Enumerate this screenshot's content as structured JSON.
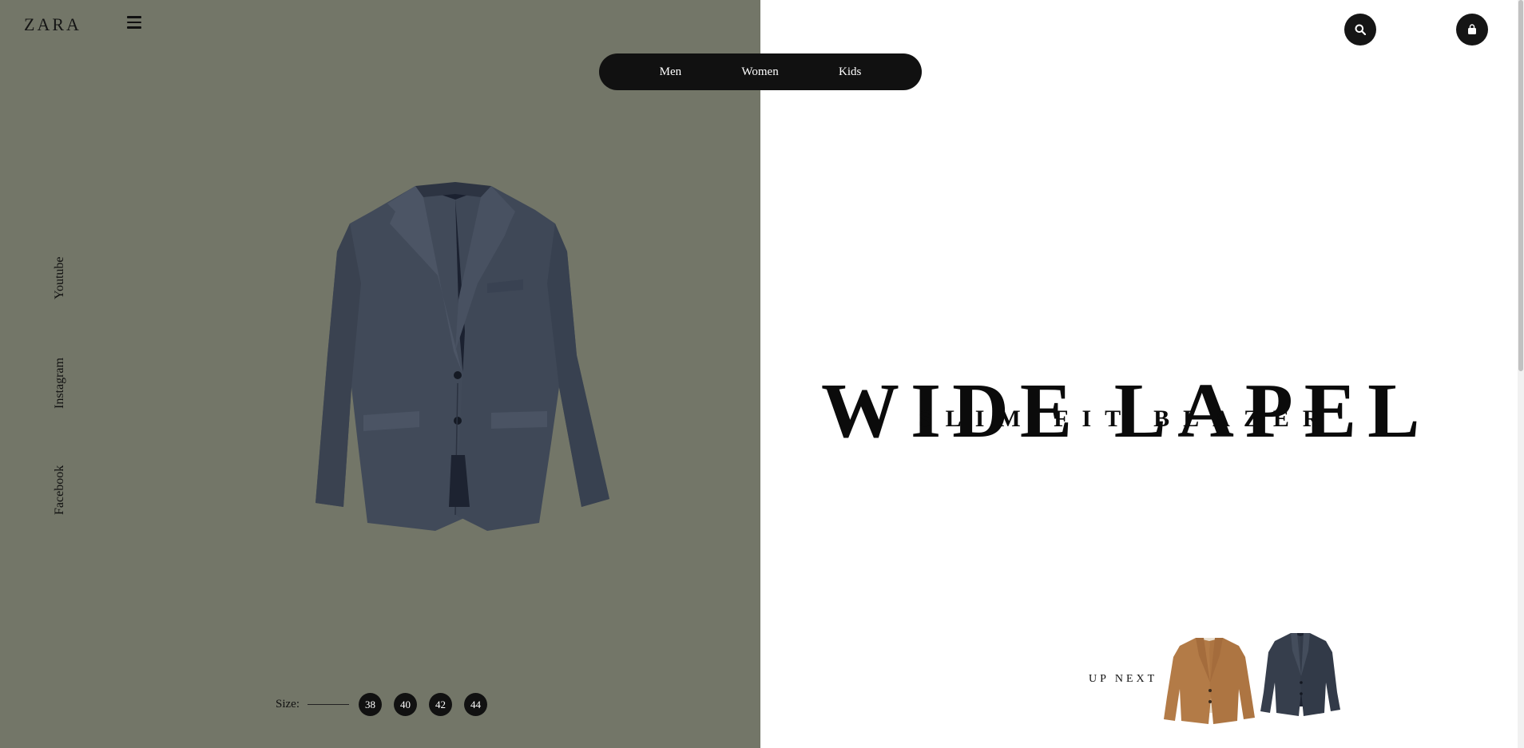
{
  "brand": {
    "logo": "ZARA"
  },
  "nav": {
    "items": [
      {
        "label": "Men"
      },
      {
        "label": "Women"
      },
      {
        "label": "Kids"
      }
    ]
  },
  "icons": {
    "menu": "hamburger-menu-icon",
    "search": "search-icon",
    "bag": "shopping-bag-icon"
  },
  "social": {
    "youtube": "Youtube",
    "instagram": "Instagram",
    "facebook": "Facebook"
  },
  "product": {
    "title": "WIDE LAPEL",
    "subtitle": "SLIM FIT BLAZER",
    "sizes_label": "Size:",
    "sizes": [
      "38",
      "40",
      "42",
      "44"
    ]
  },
  "up_next": {
    "label": "UP NEXT"
  },
  "colors": {
    "left_panel_bg": "#737668",
    "right_panel_bg": "#ffffff",
    "primary_dark": "#111111",
    "blazer_main": "#404957",
    "thumb_camel": "#b27a46",
    "thumb_navy": "#353d4b"
  }
}
